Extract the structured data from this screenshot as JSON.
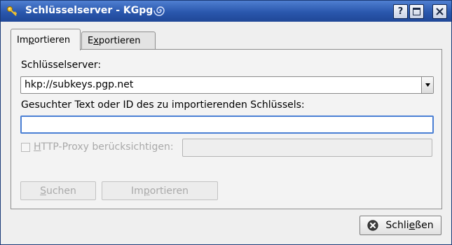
{
  "window": {
    "title": "Schlüsselserver - KGpg",
    "help_button": "?"
  },
  "tabs": [
    {
      "pre": "Im",
      "ul": "p",
      "post": "ortieren",
      "active": true
    },
    {
      "pre": "E",
      "ul": "x",
      "post": "portieren",
      "active": false
    }
  ],
  "form": {
    "server_label": "Schlüsselserver:",
    "server_value": "hkp://subkeys.pgp.net",
    "search_label": "Gesuchter Text oder ID des zu importierenden Schlüssels:",
    "search_value": "",
    "proxy_label_ul": "H",
    "proxy_label_rest": "TTP-Proxy berücksichtigen:",
    "proxy_checked": false,
    "proxy_value": ""
  },
  "buttons": {
    "search_ul": "S",
    "search_rest": "uchen",
    "import_pre": "Im",
    "import_ul": "p",
    "import_post": "ortieren",
    "close_pre": "Schli",
    "close_ul": "e",
    "close_post": "ßen"
  },
  "icons": {
    "app": "key-icon",
    "title_mark": "kde-spiral-icon",
    "close_button": "close-circle-icon"
  },
  "colors": {
    "titlebar": "#2a57ad",
    "focus": "#4a7fd4"
  }
}
